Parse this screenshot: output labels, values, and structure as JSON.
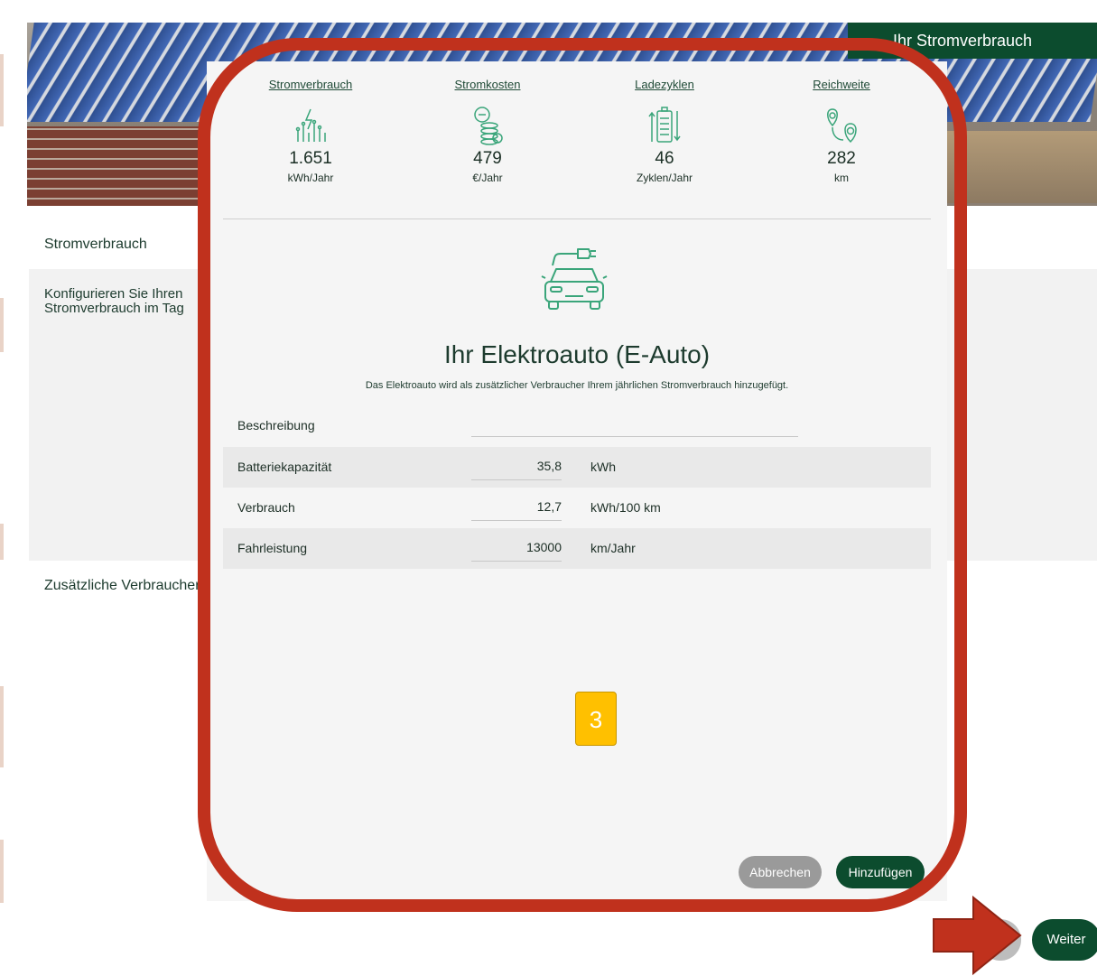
{
  "hero": {
    "tag": "Ihr Stromverbrauch"
  },
  "page": {
    "section_title": "Stromverbrauch",
    "config_text_line1": "Konfigurieren Sie Ihren",
    "config_text_line2": "Stromverbrauch im Tag",
    "extra_title": "Zusätzliche Verbraucher",
    "next_label": "Weiter"
  },
  "modal": {
    "stats": [
      {
        "label": "Stromverbrauch",
        "value": "1.651",
        "unit": "kWh/Jahr",
        "icon": "power-meter-icon"
      },
      {
        "label": "Stromkosten",
        "value": "479",
        "unit": "€/Jahr",
        "icon": "coins-icon"
      },
      {
        "label": "Ladezyklen",
        "value": "46",
        "unit": "Zyklen/Jahr",
        "icon": "battery-cycle-icon"
      },
      {
        "label": "Reichweite",
        "value": "282",
        "unit": "km",
        "icon": "route-pin-icon"
      }
    ],
    "title": "Ihr Elektroauto (E-Auto)",
    "subtitle": "Das Elektroauto wird als zusätzlicher Verbraucher Ihrem jährlichen Stromverbrauch hinzugefügt.",
    "fields": {
      "description": {
        "label": "Beschreibung",
        "value": ""
      },
      "battery": {
        "label": "Batteriekapazität",
        "value": "35,8",
        "unit": "kWh"
      },
      "consumption": {
        "label": "Verbrauch",
        "value": "12,7",
        "unit": "kWh/100 km"
      },
      "mileage": {
        "label": "Fahrleistung",
        "value": "13000",
        "unit": "km/Jahr"
      }
    },
    "cancel_label": "Abbrechen",
    "add_label": "Hinzufügen"
  },
  "annotation": {
    "step": "3"
  },
  "colors": {
    "brand": "#0c4c2e",
    "frame": "#c0311d",
    "badge": "#ffc000",
    "icon": "#3aa57a"
  }
}
